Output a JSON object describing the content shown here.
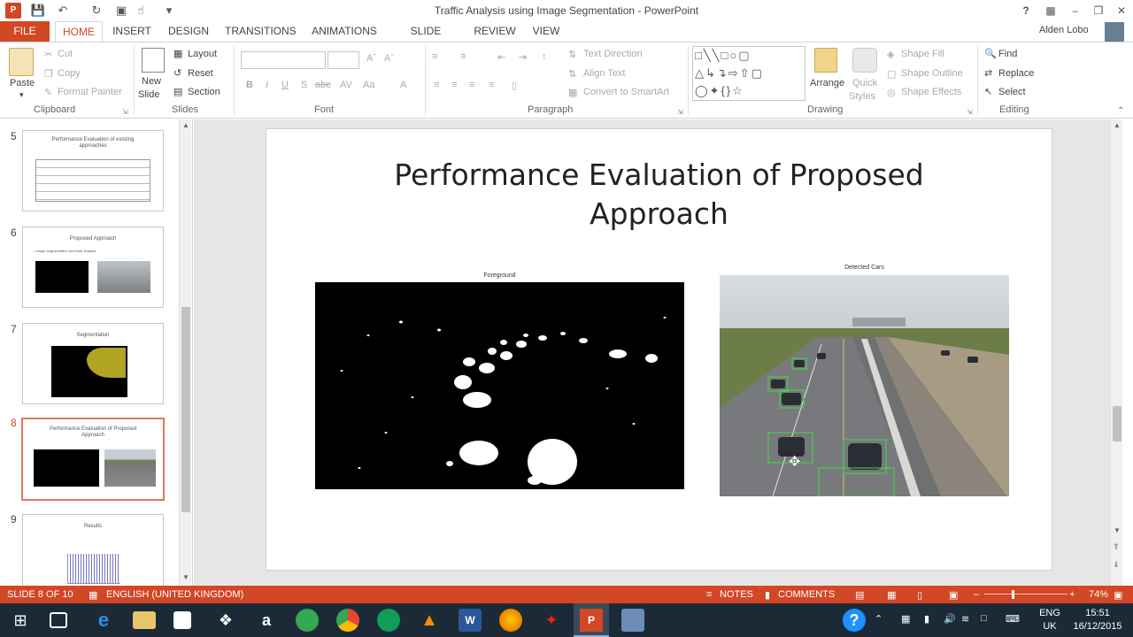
{
  "window": {
    "title": "Traffic Analysis using Image Segmentation - PowerPoint",
    "user": "Alden Lobo",
    "help": "?"
  },
  "tabs": [
    "FILE",
    "HOME",
    "INSERT",
    "DESIGN",
    "TRANSITIONS",
    "ANIMATIONS",
    "SLIDE SHOW",
    "REVIEW",
    "VIEW"
  ],
  "active_tab": "HOME",
  "ribbon": {
    "clipboard": {
      "label": "Clipboard",
      "paste": "Paste",
      "cut": "Cut",
      "copy": "Copy",
      "format_painter": "Format Painter"
    },
    "slides": {
      "label": "Slides",
      "new_slide_1": "New",
      "new_slide_2": "Slide",
      "layout": "Layout",
      "reset": "Reset",
      "section": "Section"
    },
    "font": {
      "label": "Font",
      "bold": "B",
      "italic": "I",
      "underline": "U",
      "shadow": "S",
      "strike": "abc",
      "spacing": "AV",
      "case": "Aa",
      "color": "A"
    },
    "paragraph": {
      "label": "Paragraph",
      "text_direction": "Text Direction",
      "align_text": "Align Text",
      "convert_smartart": "Convert to SmartArt"
    },
    "drawing": {
      "label": "Drawing",
      "arrange": "Arrange",
      "quick_styles_1": "Quick",
      "quick_styles_2": "Styles",
      "shape_fill": "Shape Fill",
      "shape_outline": "Shape Outline",
      "shape_effects": "Shape Effects"
    },
    "editing": {
      "label": "Editing",
      "find": "Find",
      "replace": "Replace",
      "select": "Select"
    }
  },
  "slides": [
    {
      "num": "5",
      "title": "Performance Evaluation of existing approaches"
    },
    {
      "num": "6",
      "title": "Proposed Approach",
      "bullet": "• Image segmentation and blob analysis"
    },
    {
      "num": "7",
      "title": "Segmentation"
    },
    {
      "num": "8",
      "title": "Performance Evaluation of Proposed Approach",
      "selected": true
    },
    {
      "num": "9",
      "title": "Results"
    }
  ],
  "current_slide": {
    "title_line1": "Performance Evaluation of Proposed",
    "title_line2": "Approach",
    "fig_left_caption": "Foreground",
    "fig_right_caption": "Detected Cars"
  },
  "statusbar": {
    "slide_info": "SLIDE 8 OF 10",
    "language": "ENGLISH (UNITED KINGDOM)",
    "notes": "NOTES",
    "comments": "COMMENTS",
    "zoom": "74%"
  },
  "taskbar": {
    "lang_1": "ENG",
    "lang_2": "UK",
    "time": "15:51",
    "date": "16/12/2015"
  }
}
